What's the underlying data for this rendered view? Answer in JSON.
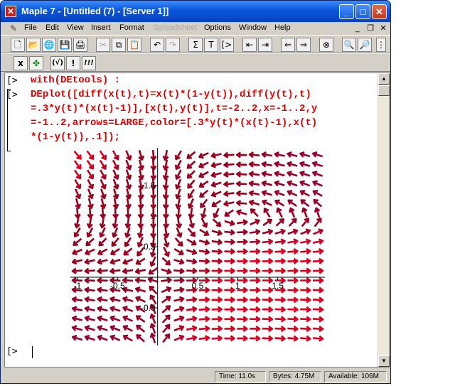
{
  "window": {
    "title": "Maple 7  - [Untitled (7) - [Server 1]]",
    "controls": {
      "minimize": "_",
      "maximize": "□",
      "close": "✕"
    },
    "doc_controls": {
      "minimize": "_",
      "restore": "❐",
      "close": "✕"
    }
  },
  "menu": [
    {
      "label": "File",
      "disabled": false
    },
    {
      "label": "Edit",
      "disabled": false
    },
    {
      "label": "View",
      "disabled": false
    },
    {
      "label": "Insert",
      "disabled": false
    },
    {
      "label": "Format",
      "disabled": false
    },
    {
      "label": "Spreadsheet",
      "disabled": true
    },
    {
      "label": "Options",
      "disabled": false
    },
    {
      "label": "Window",
      "disabled": false
    },
    {
      "label": "Help",
      "disabled": false
    }
  ],
  "toolbar1": [
    {
      "name": "new-icon",
      "glyph": "🗋"
    },
    {
      "name": "open-icon",
      "glyph": "📂"
    },
    {
      "name": "open-url-icon",
      "glyph": "🌐"
    },
    {
      "name": "save-icon",
      "glyph": "💾"
    },
    {
      "name": "print-icon",
      "glyph": "🖨"
    },
    {
      "name": "cut-icon",
      "glyph": "✂"
    },
    {
      "name": "copy-icon",
      "glyph": "⧉"
    },
    {
      "name": "paste-icon",
      "glyph": "📋"
    },
    {
      "name": "undo-icon",
      "glyph": "↶"
    },
    {
      "name": "redo-icon",
      "glyph": "↷"
    },
    {
      "name": "sum-icon",
      "glyph": "Σ"
    },
    {
      "name": "text-icon",
      "glyph": "T"
    },
    {
      "name": "prompt-icon",
      "glyph": "[>"
    },
    {
      "name": "collapse-icon",
      "glyph": "⇤"
    },
    {
      "name": "expand-icon",
      "glyph": "⇥"
    },
    {
      "name": "back-icon",
      "glyph": "⇐"
    },
    {
      "name": "forward-icon",
      "glyph": "⇒"
    },
    {
      "name": "stop-icon",
      "glyph": "⊗"
    },
    {
      "name": "zoom-in-icon",
      "glyph": "🔍"
    },
    {
      "name": "zoom-out-icon",
      "glyph": "🔎"
    },
    {
      "name": "zoom-more-icon",
      "glyph": "⋮"
    }
  ],
  "toolbar2": [
    {
      "name": "interrupt-icon",
      "glyph": "x"
    },
    {
      "name": "maple-leaf-icon",
      "glyph": "✤"
    },
    {
      "name": "check-icon",
      "glyph": "(√)"
    },
    {
      "name": "execute-icon",
      "glyph": "!"
    },
    {
      "name": "execute-all-icon",
      "glyph": "!!!"
    }
  ],
  "worksheet": {
    "prompt": "[>",
    "lines": [
      "with(DEtools) :",
      "DEplot([diff(x(t),t)=x(t)*(1-y(t)),diff(y(t),t)",
      "=.3*y(t)*(x(t)-1)],[x(t),y(t)],t=-2..2,x=-1..2,y",
      "=-1..2,arrows=LARGE,color=[.3*y(t)*(x(t)-1),x(t)",
      "*(1-y(t)),.1]);"
    ]
  },
  "chart_data": {
    "type": "vector-field",
    "x_tick_labels": [
      "-1",
      "-0.5",
      "0.5",
      "1",
      "1.5"
    ],
    "x_ticks": [
      -1,
      -0.5,
      0.5,
      1,
      1.5
    ],
    "y_tick_labels": [
      "1.5",
      "1",
      "0.5",
      "-0.5"
    ],
    "y_ticks": [
      1.5,
      1,
      0.5,
      -0.5
    ],
    "xlim": [
      -1,
      2
    ],
    "ylim": [
      -1,
      2
    ],
    "grid_n": 20,
    "equations": {
      "dx": "x*(1-y)",
      "dy": "0.3*y*(x-1)"
    }
  },
  "status": {
    "time": "Time: 11.0s",
    "bytes": "Bytes: 4.75M",
    "available": "Available: 106M"
  }
}
